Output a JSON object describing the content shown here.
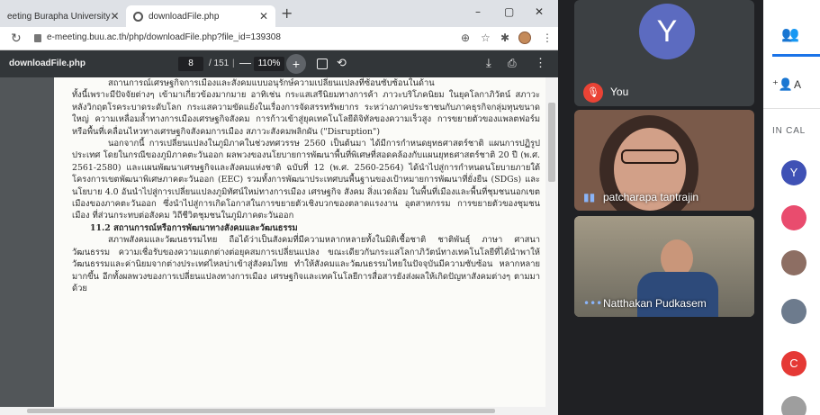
{
  "browser": {
    "tabs": [
      {
        "label": "eeting Burapha University",
        "active": false
      },
      {
        "label": "downloadFile.php",
        "active": true
      }
    ],
    "new_tab": "+",
    "controls": {
      "minimize": "–",
      "maximize": "▢",
      "close": "✕"
    },
    "url": "e-meeting.buu.ac.th/php/downloadFile.php?file_id=139308"
  },
  "pdf": {
    "title": "downloadFile.php",
    "page_current": "8",
    "page_total": "/ 151",
    "zoom": "110%",
    "paragraphs": [
      {
        "cls": "ind",
        "text": "สถานการณ์เศรษฐกิจการเมืองและสังคมแบบอนุรักษ์ความเปลี่ยนแปลงที่ซ้อนซับซ้อนในด้าน"
      },
      {
        "cls": "",
        "text": "ทั้งนี้เพราะมีปัจจัยต่างๆ เข้ามาเกี่ยวข้องมากมาย อาทิเช่น กระแสเสรีนิยมทางการค้า ภาวะบริโภคนิยม ในยุคโลกาภิวัตน์ สภาวะหลังวิกฤตโรคระบาดระดับโลก กระแสความขัดแย้งในเรื่องการจัดสรรทรัพยากร ระหว่างภาคประชาชนกับภาคธุรกิจกลุ่มทุนขนาดใหญ่ ความเหลื่อมล้ำทางการเมืองเศรษฐกิจสังคม การก้าวเข้าสู่ยุคเทคโนโลยีดิจิทัลของความเร็วสูง การขยายตัวของแพลตฟอร์มหรือพื้นที่เคลื่อนไหวทางเศรษฐกิจสังคมการเมือง สภาวะสังคมพลิกผัน (\"Disruption\")"
      },
      {
        "cls": "ind",
        "text": "นอกจากนี้ การเปลี่ยนแปลงในภูมิภาคในช่วงทศวรรษ 2560 เป็นต้นมา ได้มีการกำหนดยุทธศาสตร์ชาติ แผนการปฏิรูปประเทศ โดยในกรณีของภูมิภาคตะวันออก ผลพวงของนโยบายการพัฒนาพื้นที่พิเศษที่สอดคล้องกับแผนยุทธศาสตร์ชาติ 20 ปี (พ.ศ. 2561-2580) และแผนพัฒนาเศรษฐกิจและสังคมแห่งชาติ ฉบับที่ 12 (พ.ศ. 2560-2564) ได้นำไปสู่การกำหนดนโยบายภายใต้โครงการเขตพัฒนาพิเศษภาคตะวันออก (EEC) รวมทั้งการพัฒนาประเทศบนพื้นฐานของเป้าหมายการพัฒนาที่ยั่งยืน (SDGs) และนโยบาย 4.0 อันนำไปสู่การเปลี่ยนแปลงภูมิทัศน์ใหม่ทางการเมือง เศรษฐกิจ สังคม สิ่งแวดล้อม ในพื้นที่เมืองและพื้นที่ชุมชนนอกเขตเมืองของภาคตะวันออก ซึ่งนำไปสู่การเกิดโอกาสในการขยายตัวเชิงบวกของตลาดแรงงาน อุตสาหกรรม การขยายตัวของชุมชนเมือง ที่ส่วนกระทบต่อสังคม วิถีชีวิตชุมชนในภูมิภาคตะวันออก"
      },
      {
        "cls": "hd",
        "text": "11.2 สถานการณ์หรือการพัฒนาทางสังคมและวัฒนธรรม"
      },
      {
        "cls": "ind",
        "text": "สภาพสังคมและวัฒนธรรมไทย ถือได้ว่าเป็นสังคมที่มีความหลากหลายทั้งในมิติเชื้อชาติ ชาติพันธุ์ ภาษา ศาสนา วัฒนธรรม ความเชื่อรับของความแตกต่างต่อยุคสมการเปลี่ยนแปลง ขณะเดียวกันกระแสโลกาภิวัตน์ทางเทคโนโลยีที่ได้นำพาให้วัฒนธรรมและค่านิยมจากต่างประเทศไหลบ่าเข้าสู่สังคมไทย ทำให้สังคมและวัฒนธรรมไทยในปัจจุบันมีความซับซ้อน หลากหลายมากขึ้น อีกทั้งผลพวงของการเปลี่ยนแปลงทางการเมือง เศรษฐกิจและเทคโนโลยีการสื่อสารยังส่งผลให้เกิดปัญหาสังคมต่างๆ ตามมาด้วย"
      }
    ]
  },
  "meet": {
    "you": {
      "initial": "Y",
      "label": "You"
    },
    "participants": [
      {
        "name": "patcharapa tantrajin"
      },
      {
        "name": "Natthakan Pudkasem"
      }
    ]
  },
  "panel": {
    "add_label": "A",
    "in_call": "IN CAL",
    "avatars": [
      {
        "initial": "Y",
        "color": "#3f51b5"
      },
      {
        "initial": "",
        "color": "#e94c6e"
      },
      {
        "initial": "",
        "color": "#8d6e63"
      },
      {
        "initial": "",
        "color": "#6d7b8d"
      },
      {
        "initial": "C",
        "color": "#e53935"
      },
      {
        "initial": "",
        "color": "#9e9e9e"
      }
    ]
  },
  "colors": {
    "accent": "#1a73e8",
    "mute": "#ea4335",
    "you_avatar": "#5c6bc0"
  }
}
